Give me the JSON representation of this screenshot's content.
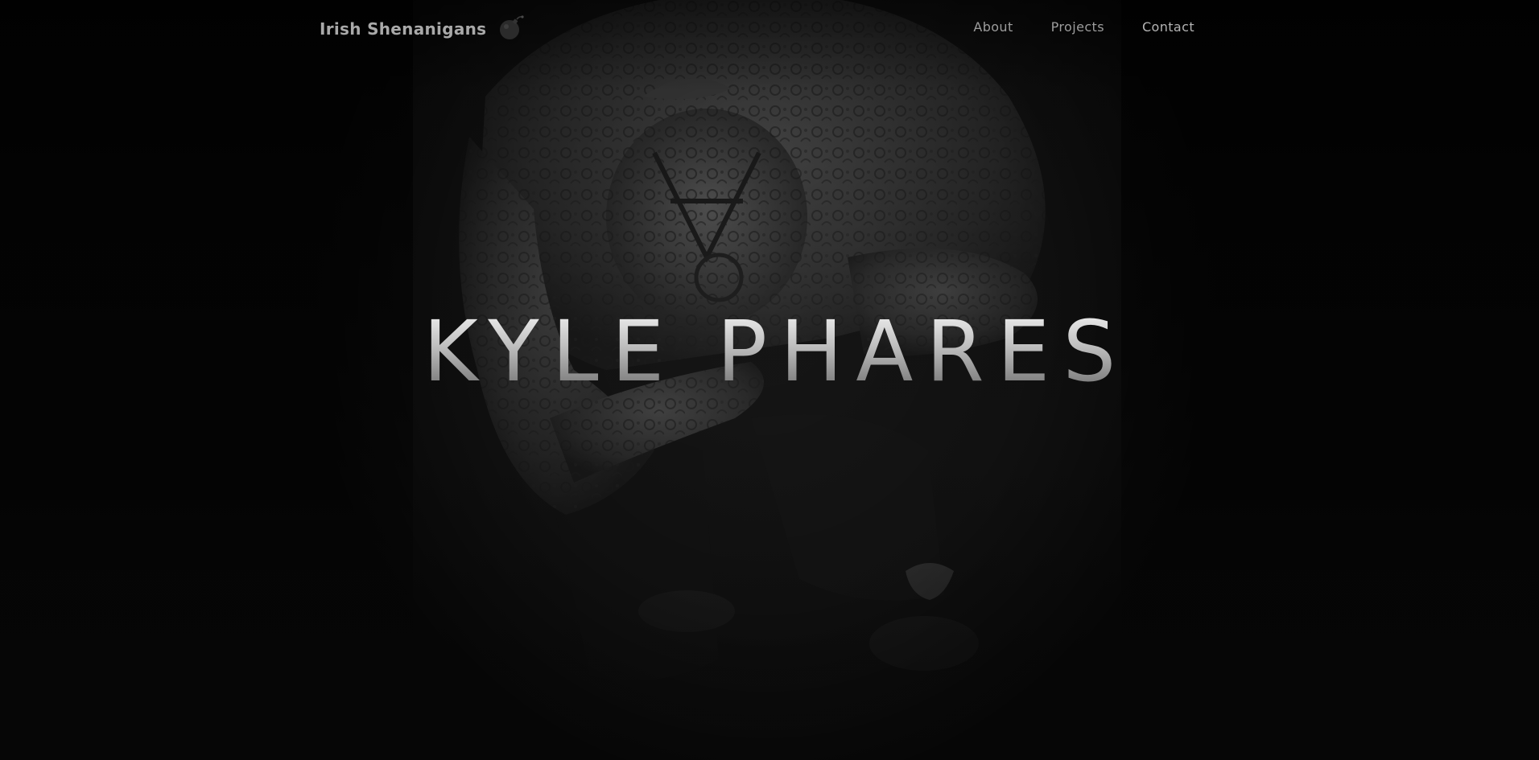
{
  "site": {
    "brand_name": "Irish Shenanigans",
    "brand_icon": "bomb-icon"
  },
  "nav": {
    "links": [
      {
        "label": "About"
      },
      {
        "label": "Projects"
      },
      {
        "label": "Contact"
      }
    ]
  },
  "hero": {
    "title": "KYLE PHARES",
    "image_description_icon": "tattooed-person-photo"
  },
  "colors": {
    "background": "#0a0a0a",
    "nav_text": "#9c9c9c",
    "brand_text": "#a9a9a9",
    "title_top": "#f2f2f2",
    "title_bottom": "#6e6e6e"
  }
}
